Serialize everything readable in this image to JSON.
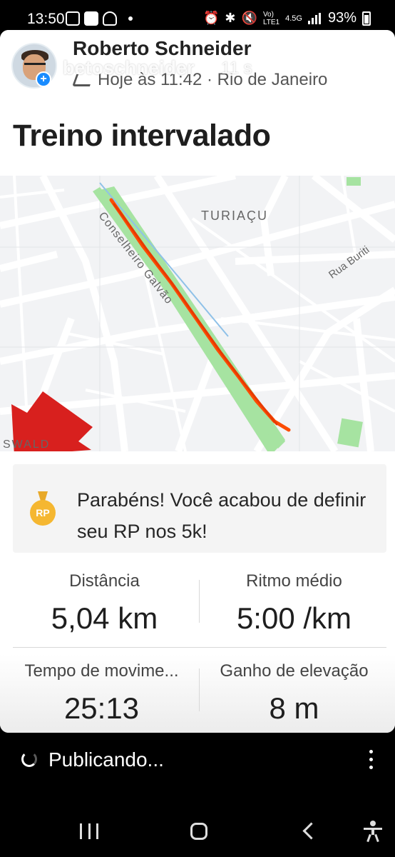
{
  "status_bar": {
    "time": "13:50",
    "network_top": "Vo)",
    "network_bottom": "LTE1",
    "data_top": "4.5G",
    "battery_percent": "93%",
    "icons": [
      "gallery-icon",
      "photo-icon",
      "drive-icon",
      "alarm-icon",
      "bluetooth-icon",
      "mute-icon",
      "signal-icon",
      "battery-icon"
    ]
  },
  "story": {
    "username": "betoschneider",
    "time_ago": "11 s",
    "progress": 0.55
  },
  "activity": {
    "athlete_name": "Roberto Schneider",
    "meta": "Hoje às 11:42 · Rio de Janeiro",
    "title": "Treino intervalado"
  },
  "map": {
    "labels": {
      "street_conselheiro": "Conselheiro Galvão",
      "neighborhood": "TURIAÇU",
      "street_buriti": "Rua Buriti",
      "oswaldo": "SWALD"
    },
    "route_color": "#fc4c02",
    "park_color": "#a6e3a1"
  },
  "achievement": {
    "medal_text": "RP",
    "message": "Parabéns! Você acabou de definir seu RP nos 5k!"
  },
  "stats": {
    "distance_label": "Distância",
    "distance_value": "5,04 km",
    "pace_label": "Ritmo médio",
    "pace_value": "5:00 /km",
    "moving_time_label": "Tempo de movime...",
    "moving_time_value": "25:13",
    "elevation_label": "Ganho de elevação",
    "elevation_value": "8 m"
  },
  "publishing": {
    "text": "Publicando..."
  }
}
